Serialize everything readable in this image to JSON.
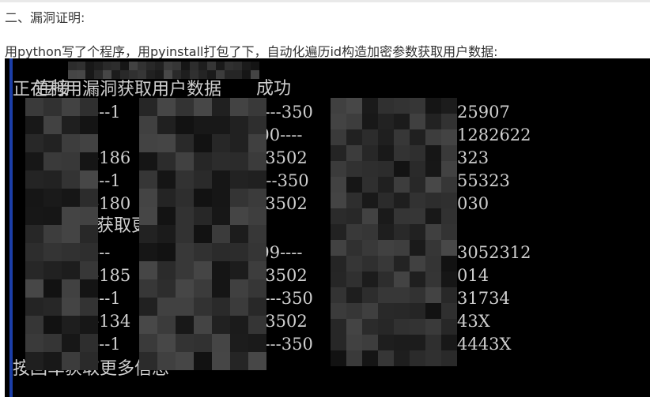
{
  "article": {
    "section_title": "二、漏洞证明:",
    "description": "用python写了个程序，用pyinstall打包了下，自动化遍历id构造加密参数获取用户数据:"
  },
  "console": {
    "lines": [
      {
        "segments": [
          "连接",
          "成功"
        ]
      },
      {
        "segments": [
          "正在利用漏洞获取用户数据"
        ]
      }
    ],
    "records_block1": [
      {
        "c1": "---1",
        "c2": "3----350",
        "c3": "25907"
      },
      {
        "c1": "",
        "c2": "000----",
        "c3": "1282622"
      },
      {
        "c1": "-186",
        "c2": "---3502",
        "c3": "323"
      },
      {
        "c1": "---1",
        "c2": ")----350",
        "c3": "55323"
      },
      {
        "c1": "-180",
        "c2": "---3502",
        "c3": "030"
      }
    ],
    "prompt_partial": "获取更",
    "records_block2": [
      {
        "c1": "---",
        "c2": "599----",
        "c3": "3052312"
      },
      {
        "c1": "-185",
        "c2": "---3502",
        "c3": "014"
      },
      {
        "c1": "---1",
        "c2": "7----350",
        "c3": "31734"
      },
      {
        "c1": "-134",
        "c2": "---3502",
        "c3": "43X"
      },
      {
        "c1": "---1",
        "c2": "7----350",
        "c3": "4443X"
      }
    ],
    "final_prompt": "按回车获取更多信息"
  },
  "colors": {
    "console_bg": "#000000",
    "console_text": "#cfcfcf",
    "accent_bar": "#1b3ea8"
  }
}
